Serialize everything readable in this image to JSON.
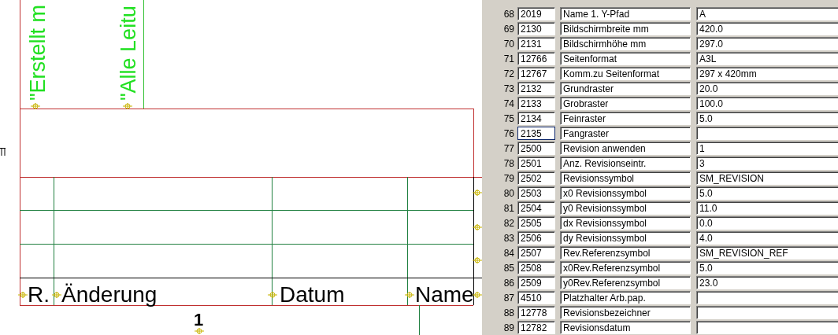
{
  "drawing": {
    "vertical_texts": [
      "\"Erstellt m",
      "\"Alle Leitu"
    ],
    "revision_table": {
      "columns": [
        "R.",
        "Änderung",
        "Datum",
        "Name"
      ]
    },
    "sheet_number": "1"
  },
  "properties": {
    "rows": [
      {
        "number": "68",
        "id": "2019",
        "name": "Name 1. Y-Pfad",
        "value": "A",
        "focused": false
      },
      {
        "number": "69",
        "id": "2130",
        "name": "Bildschirmbreite mm",
        "value": "420.0",
        "focused": false
      },
      {
        "number": "70",
        "id": "2131",
        "name": "Bildschirmhöhe mm",
        "value": "297.0",
        "focused": false
      },
      {
        "number": "71",
        "id": "12766",
        "name": "Seitenformat",
        "value": "A3L",
        "focused": false
      },
      {
        "number": "72",
        "id": "12767",
        "name": "Komm.zu Seitenformat",
        "value": "297 x 420mm",
        "focused": false
      },
      {
        "number": "73",
        "id": "2132",
        "name": "Grundraster",
        "value": "20.0",
        "focused": false
      },
      {
        "number": "74",
        "id": "2133",
        "name": "Grobraster",
        "value": "100.0",
        "focused": false
      },
      {
        "number": "75",
        "id": "2134",
        "name": "Feinraster",
        "value": "5.0",
        "focused": false
      },
      {
        "number": "76",
        "id": "2135",
        "name": "Fangraster",
        "focused": true
      },
      {
        "number": "77",
        "id": "2500",
        "name": "Revision anwenden",
        "value": "1",
        "focused": false
      },
      {
        "number": "78",
        "id": "2501",
        "name": "Anz. Revisionseintr.",
        "value": "3",
        "focused": false
      },
      {
        "number": "79",
        "id": "2502",
        "name": "Revisionssymbol",
        "value": "SM_REVISION",
        "focused": false
      },
      {
        "number": "80",
        "id": "2503",
        "name": "x0 Revisionssymbol",
        "value": "5.0",
        "focused": false
      },
      {
        "number": "81",
        "id": "2504",
        "name": "y0 Revisionssymbol",
        "value": "11.0",
        "focused": false
      },
      {
        "number": "82",
        "id": "2505",
        "name": "dx Revisionssymbol",
        "value": "0.0",
        "focused": false
      },
      {
        "number": "83",
        "id": "2506",
        "name": "dy Revisionssymbol",
        "value": "4.0",
        "focused": false
      },
      {
        "number": "84",
        "id": "2507",
        "name": "Rev.Referenzsymbol",
        "value": "SM_REVISION_REF",
        "focused": false
      },
      {
        "number": "85",
        "id": "2508",
        "name": "x0Rev.Referenzsymbol",
        "value": "5.0",
        "focused": false
      },
      {
        "number": "86",
        "id": "2509",
        "name": "y0Rev.Referenzsymbol",
        "value": "23.0",
        "focused": false
      },
      {
        "number": "87",
        "id": "4510",
        "name": "Platzhalter Arb.pap.",
        "focused": false
      },
      {
        "number": "88",
        "id": "12778",
        "name": "Revisionsbezeichner",
        "focused": false
      },
      {
        "number": "89",
        "id": "12782",
        "name": "Revisionsdatum",
        "focused": false
      }
    ]
  }
}
